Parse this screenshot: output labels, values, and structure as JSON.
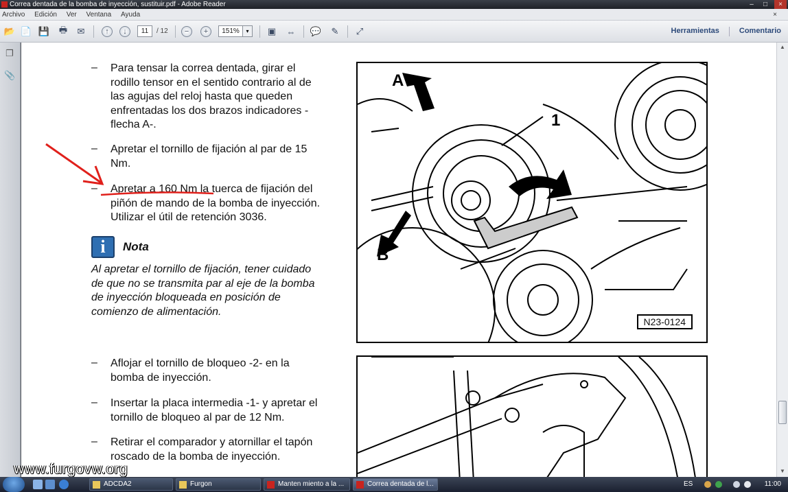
{
  "window": {
    "title": "Correa dentada de la bomba de inyección, sustituir.pdf - Adobe Reader"
  },
  "menu": {
    "items": [
      "Archivo",
      "Edición",
      "Ver",
      "Ventana",
      "Ayuda"
    ],
    "close_doc": "×"
  },
  "toolbar": {
    "current_page": "11",
    "total_pages": "/ 12",
    "zoom": "151%",
    "tools_label": "Herramientas",
    "comment_label": "Comentario"
  },
  "document": {
    "steps_top": [
      {
        "dash": "–",
        "lines": [
          "Para tensar la correa dentada, girar el",
          "rodillo tensor en el sentido contrario al de",
          "las agujas del reloj hasta que queden",
          "enfrentadas los dos brazos indicadores -",
          "flecha A-."
        ]
      },
      {
        "dash": "–",
        "lines": [
          "Apretar el tornillo de fijación al par de 15",
          "Nm."
        ]
      },
      {
        "dash": "–",
        "lines": [
          "Apretar a 160 Nm la tuerca de fijación del",
          "piñón de mando de la bomba de inyección.",
          "Utilizar el útil de retención 3036."
        ]
      }
    ],
    "note": {
      "icon_letter": "i",
      "title": "Nota",
      "lines": [
        "Al apretar el tornillo de fijación, tener cuidado",
        "de que no se transmita par al eje de la bomba",
        "de inyección bloqueada en posición de",
        "comienzo de alimentación."
      ]
    },
    "figure_top": {
      "label": "N23-0124",
      "callout_a": "A",
      "callout_b": "B",
      "callout_1": "1"
    },
    "steps_bottom": [
      {
        "dash": "–",
        "lines": [
          "Aflojar el tornillo de bloqueo -2- en la",
          "bomba de inyección."
        ]
      },
      {
        "dash": "–",
        "lines": [
          "Insertar la placa intermedia -1- y apretar el",
          "tornillo de bloqueo al par de 12 Nm."
        ]
      },
      {
        "dash": "–",
        "lines": [
          "Retirar el comparador y atornillar el tapón",
          "roscado de la bomba de inyección."
        ]
      }
    ]
  },
  "watermark": "www.furgovw.org",
  "taskbar": {
    "tasks": [
      {
        "label": "ADCDA2"
      },
      {
        "label": "Furgon"
      },
      {
        "label": "Manten miento a la ..."
      },
      {
        "label": "Correa dentada de l..."
      }
    ],
    "lang": "ES",
    "clock": "11:00"
  },
  "colors": {
    "annotation_red": "#e0201b",
    "page_bg": "#ffffff",
    "chrome_bg": "#5c5f66"
  }
}
